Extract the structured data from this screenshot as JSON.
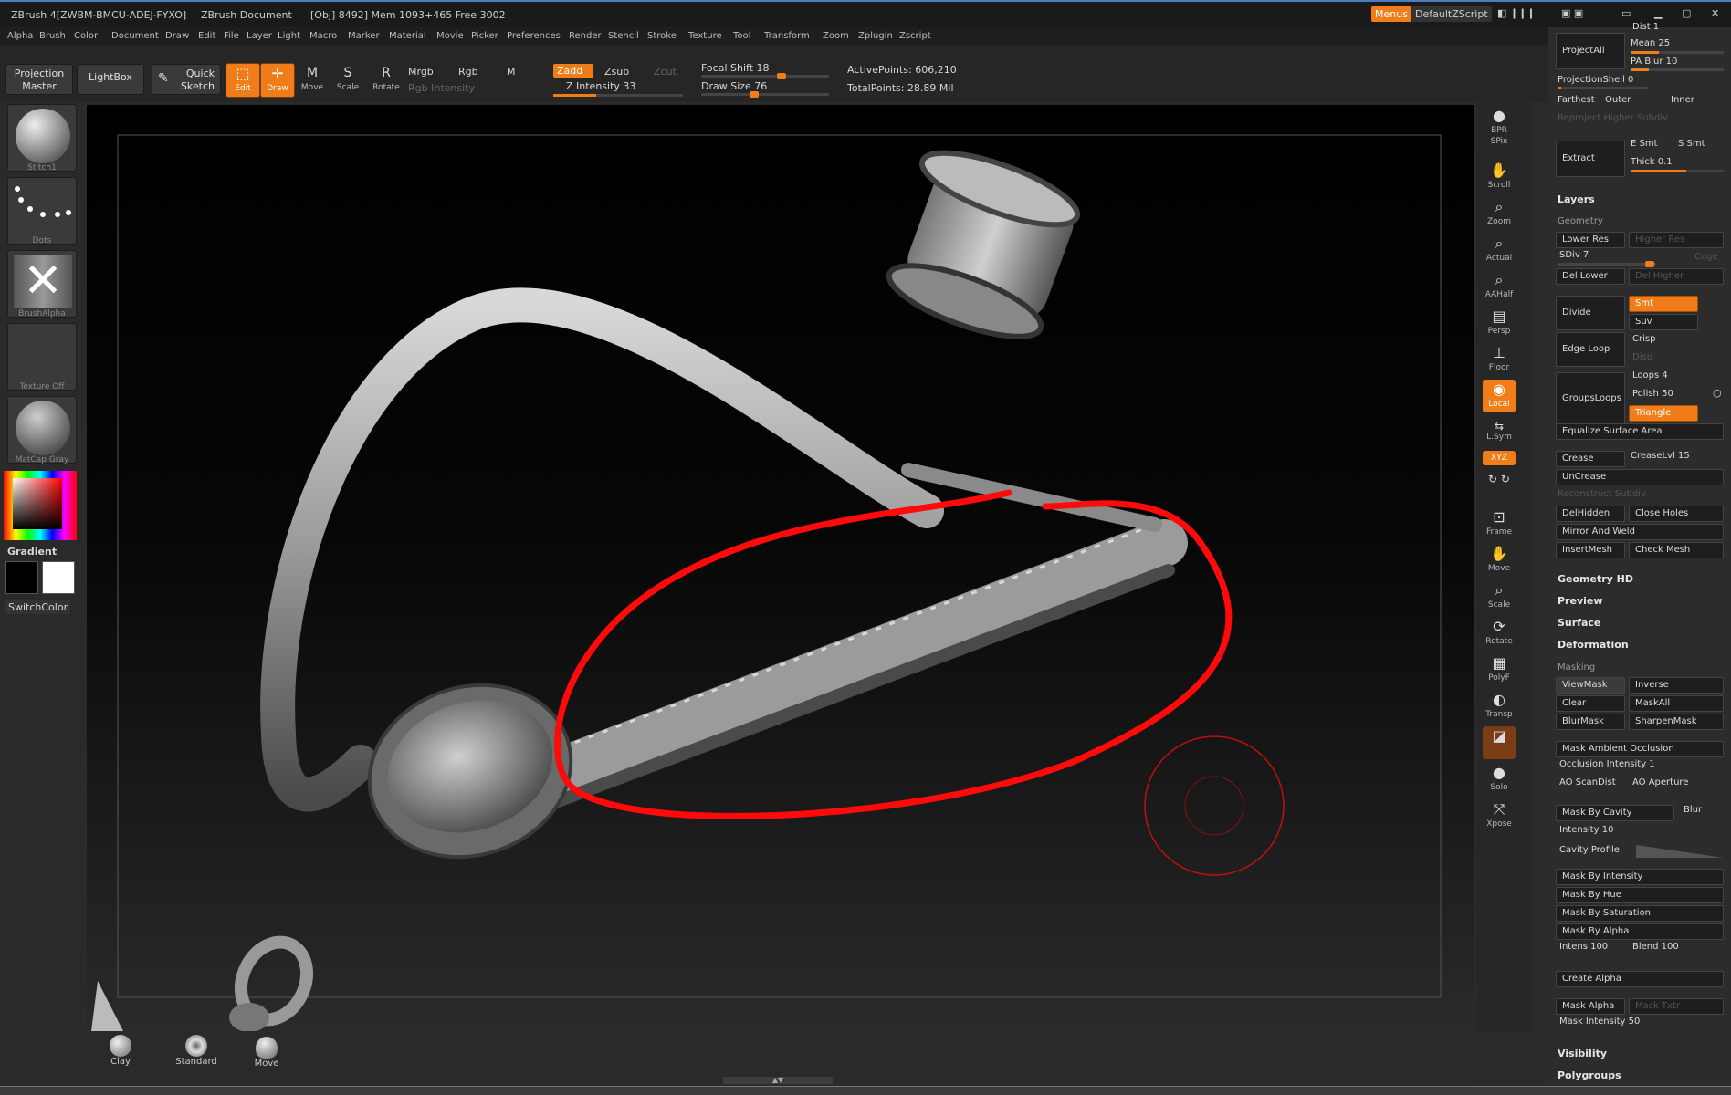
{
  "titlebar": {
    "app": "ZBrush 4[ZWBM-BMCU-ADEJ-FYXO]",
    "doc": "ZBrush Document",
    "stats": "[Obj] 8492] Mem 1093+465 Free 3002",
    "menus_btn": "Menus",
    "script": "DefaultZScript"
  },
  "menubar": [
    "Alpha",
    "Brush",
    "Color",
    "Document",
    "Draw",
    "Edit",
    "File",
    "Layer",
    "Light",
    "Macro",
    "Marker",
    "Material",
    "Movie",
    "Picker",
    "Preferences",
    "Render",
    "Stencil",
    "Stroke",
    "Texture",
    "Tool",
    "Transform",
    "Zoom",
    "Zplugin",
    "Zscript"
  ],
  "toolbar": {
    "projection_master_1": "Projection",
    "projection_master_2": "Master",
    "lightbox": "LightBox",
    "quick_sketch_1": "Quick",
    "quick_sketch_2": "Sketch",
    "edit": "Edit",
    "draw": "Draw",
    "move": "Move",
    "scale": "Scale",
    "rotate": "Rotate",
    "mrgb": "Mrgb",
    "rgb": "Rgb",
    "m": "M",
    "rgb_intensity": "Rgb Intensity",
    "zadd": "Zadd",
    "zsub": "Zsub",
    "zcut": "Zcut",
    "z_intensity": "Z Intensity 33",
    "z_intensity_value": 33,
    "focal_shift": "Focal Shift 18",
    "focal_shift_value": 18,
    "draw_size": "Draw Size 76",
    "draw_size_value": 76,
    "active_points": "ActivePoints: 606,210",
    "total_points": "TotalPoints: 28.89 Mil"
  },
  "leftshelf": {
    "brush": "Stitch1",
    "stroke": "Dots",
    "alpha": "BrushAlpha",
    "texture": "Texture Off",
    "material": "MatCap Gray",
    "gradient": "Gradient",
    "switchcolor": "SwitchColor"
  },
  "rightshelf": [
    "BPR",
    "SPix",
    "Scroll",
    "Zoom",
    "Actual",
    "AAHalf",
    "Persp",
    "Floor",
    "Local",
    "L.Sym",
    "XYZ",
    "Frame",
    "Move",
    "Scale",
    "Rotate",
    "PolyF",
    "Transp",
    "Solo",
    "Xpose"
  ],
  "bottom_brushes": [
    "Clay",
    "Standard",
    "Move"
  ],
  "panel": {
    "dist": "Dist 1",
    "projectall": "ProjectAll",
    "mean": "Mean 25",
    "pa_blur": "PA Blur 10",
    "projection_shell": "ProjectionShell 0",
    "farthest": "Farthest",
    "outer": "Outer",
    "inner": "Inner",
    "reproject": "Reproject Higher Subdiv",
    "extract": "Extract",
    "e_smt": "E Smt",
    "s_smt": "S Smt",
    "thick": "Thick 0.1",
    "layers": "Layers",
    "geometry": "Geometry",
    "lower_res": "Lower Res",
    "higher_res": "Higher Res",
    "sdiv": "SDiv 7",
    "cage": "Cage",
    "del_lower": "Del Lower",
    "del_higher": "Del Higher",
    "divide": "Divide",
    "smt": "Smt",
    "suv": "Suv",
    "edge_loop": "Edge Loop",
    "crisp": "Crisp",
    "disp": "Disp",
    "loops": "Loops 4",
    "groups_loops": "GroupsLoops",
    "polish": "Polish 50",
    "triangle": "Triangle",
    "equalize": "Equalize Surface Area",
    "crease": "Crease",
    "crease_lvl": "CreaseLvl 15",
    "uncrease": "UnCrease",
    "reconstruct": "Reconstruct Subdiv",
    "del_hidden": "DelHidden",
    "close_holes": "Close Holes",
    "mirror_weld": "Mirror And Weld",
    "insert_mesh": "InsertMesh",
    "check_mesh": "Check Mesh",
    "geometry_hd": "Geometry HD",
    "preview": "Preview",
    "surface": "Surface",
    "deformation": "Deformation",
    "masking": "Masking",
    "viewmask": "ViewMask",
    "inverse": "Inverse",
    "clear": "Clear",
    "maskall": "MaskAll",
    "blurmask": "BlurMask",
    "sharpenmask": "SharpenMask",
    "mask_ao": "Mask Ambient Occlusion",
    "occlusion_intensity": "Occlusion Intensity 1",
    "ao_scandist": "AO ScanDist",
    "ao_aperture": "AO Aperture",
    "mask_by_cavity": "Mask By Cavity",
    "blur": "Blur",
    "intensity": "Intensity 10",
    "cavity_profile": "Cavity Profile",
    "mask_by_intensity": "Mask By Intensity",
    "mask_by_hue": "Mask By Hue",
    "mask_by_saturation": "Mask By Saturation",
    "mask_by_alpha": "Mask By Alpha",
    "intens": "Intens 100",
    "blend": "Blend 100",
    "create_alpha": "Create Alpha",
    "mask_alpha": "Mask Alpha",
    "mask_txtr": "Mask Txtr",
    "mask_intensity": "Mask Intensity 50",
    "visibility": "Visibility",
    "polygroups": "Polygroups"
  },
  "colors": {
    "accent": "#f07d1a",
    "annotation_red": "#ff0a0a",
    "cursor_red": "#c01010"
  }
}
